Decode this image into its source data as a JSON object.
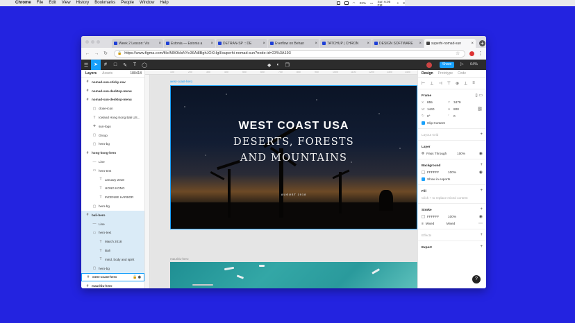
{
  "menubar": {
    "app": "Chrome",
    "items": [
      "File",
      "Edit",
      "View",
      "History",
      "Bookmarks",
      "People",
      "Window",
      "Help"
    ],
    "battery": "22%",
    "clock": "Sun 6:05 PM"
  },
  "browser": {
    "tabs": [
      {
        "title": "Week 2 Lesson: Vis"
      },
      {
        "title": "Estonia — Estonia a"
      },
      {
        "title": "DETRAN-SP :: DE"
      },
      {
        "title": "Everflow on Behan"
      },
      {
        "title": "TATCHUP | CHRON"
      },
      {
        "title": "DESIGN SOFTWARE"
      },
      {
        "title": "superhi-nomad-sun"
      }
    ],
    "url": "https://www.figma.com/file/M9OkIsNYc36Ai8BghJOXHgII/superhi-nomad-sun?node-id=23%3A193"
  },
  "figma": {
    "share_label": "Share",
    "zoom": "64%",
    "left_tabs": {
      "layers": "Layers",
      "assets": "Assets",
      "page": "180418"
    },
    "layers": [
      {
        "name": "nomad-sun-sticky-nav",
        "depth": 0,
        "icon": "frame"
      },
      {
        "name": "nomad-sun-desktop-menu",
        "depth": 0,
        "icon": "frame"
      },
      {
        "name": "nomad-sun-desktop-menu",
        "depth": 0,
        "icon": "frame"
      },
      {
        "name": "close-icon",
        "depth": 1,
        "icon": "image"
      },
      {
        "name": "Iceland Hong Kong Bali US...",
        "depth": 1,
        "icon": "text"
      },
      {
        "name": "sun-logo",
        "depth": 1,
        "icon": "component"
      },
      {
        "name": "Group",
        "depth": 1,
        "icon": "image"
      },
      {
        "name": "hero-bg",
        "depth": 1,
        "icon": "image"
      },
      {
        "name": "hong-kong-hero",
        "depth": 0,
        "icon": "frame"
      },
      {
        "name": "Line",
        "depth": 1,
        "icon": "line"
      },
      {
        "name": "hero-text",
        "depth": 1,
        "icon": "group"
      },
      {
        "name": "January 2018",
        "depth": 2,
        "icon": "text"
      },
      {
        "name": "HONG KONG",
        "depth": 2,
        "icon": "text"
      },
      {
        "name": "INCENSE HARBOR",
        "depth": 2,
        "icon": "text"
      },
      {
        "name": "hero-bg",
        "depth": 1,
        "icon": "image"
      },
      {
        "name": "bali-hero",
        "depth": 0,
        "icon": "frame",
        "selected": true
      },
      {
        "name": "Line",
        "depth": 1,
        "icon": "line",
        "selected": true
      },
      {
        "name": "hero-text",
        "depth": 1,
        "icon": "group",
        "selected": true
      },
      {
        "name": "March 2018",
        "depth": 2,
        "icon": "text",
        "selected": true
      },
      {
        "name": "Bali",
        "depth": 2,
        "icon": "text",
        "selected": true
      },
      {
        "name": "mind, body and spirit",
        "depth": 2,
        "icon": "text",
        "selected": true
      },
      {
        "name": "hero-bg",
        "depth": 1,
        "icon": "image",
        "selected": true
      },
      {
        "name": "west-coast-hero",
        "depth": 0,
        "icon": "frame",
        "active": true
      },
      {
        "name": "mauritiu-hero",
        "depth": 0,
        "icon": "frame"
      }
    ],
    "ruler_ticks": [
      "100",
      "200",
      "300",
      "400",
      "500",
      "600",
      "700",
      "800",
      "900",
      "1000",
      "1100",
      "1200",
      "1300",
      "1400"
    ],
    "canvas": {
      "frame_label": "west-coast-hero",
      "hero_title": "WEST COAST USA",
      "hero_sub1": "DESERTS, FORESTS",
      "hero_sub2": "AND MOUNTAINS",
      "hero_date": "AUGUST 2018",
      "next_frame_label": "mauritiu-hero"
    },
    "right_tabs": {
      "design": "Design",
      "prototype": "Prototype",
      "code": "Code"
    },
    "frame": {
      "label": "Frame",
      "x": "855",
      "y": "3479",
      "w": "1440",
      "h": "800",
      "rotation": "0°",
      "radius": "0",
      "clip": "Clip Content"
    },
    "layout_grid": "Layout Grid",
    "layer": {
      "label": "Layer",
      "blend": "Pass Through",
      "opacity": "100%"
    },
    "background": {
      "label": "Background",
      "hex": "FFFFFF",
      "opacity": "100%",
      "exports": "Show in exports"
    },
    "fill": {
      "label": "Fill",
      "hint": "Click + to replace mixed content"
    },
    "stroke": {
      "label": "Stroke",
      "hex": "FFFFFF",
      "opacity": "100%",
      "weight": "Mixed",
      "align": "Mixed"
    },
    "effects": "Effects",
    "export": "Export"
  },
  "colors": {
    "accent": "#18a0fb",
    "desktop": "#2323e0",
    "figbar": "#2c2c2c"
  }
}
